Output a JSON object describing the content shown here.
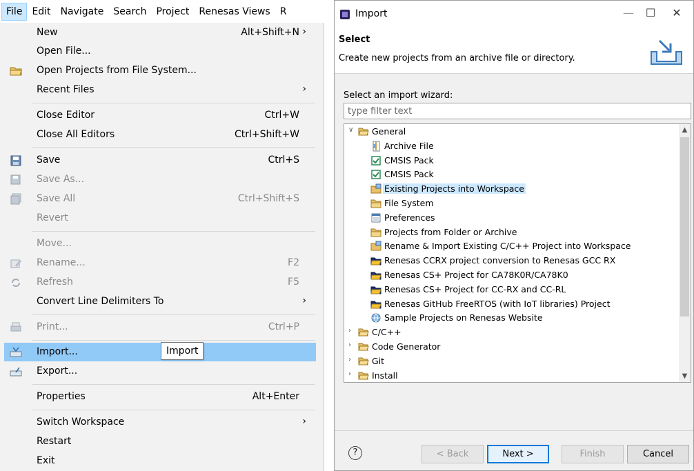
{
  "menubar": {
    "items": [
      "File",
      "Edit",
      "Navigate",
      "Search",
      "Project",
      "Renesas Views",
      "R"
    ]
  },
  "file_menu": {
    "items": [
      {
        "label": "New",
        "accel": "Alt+Shift+N",
        "submenu": true,
        "icon": "none",
        "disabled": false
      },
      {
        "label": "Open File...",
        "accel": "",
        "submenu": false,
        "icon": "none",
        "disabled": false
      },
      {
        "label": "Open Projects from File System...",
        "accel": "",
        "submenu": false,
        "icon": "folder-icon",
        "disabled": false
      },
      {
        "label": "Recent Files",
        "accel": "",
        "submenu": true,
        "icon": "none",
        "disabled": false
      },
      {
        "label": "Close Editor",
        "accel": "Ctrl+W",
        "submenu": false,
        "icon": "none",
        "disabled": false
      },
      {
        "label": "Close All Editors",
        "accel": "Ctrl+Shift+W",
        "submenu": false,
        "icon": "none",
        "disabled": false
      },
      {
        "label": "Save",
        "accel": "Ctrl+S",
        "submenu": false,
        "icon": "save-icon",
        "disabled": false
      },
      {
        "label": "Save As...",
        "accel": "",
        "submenu": false,
        "icon": "save-as-icon",
        "disabled": true
      },
      {
        "label": "Save All",
        "accel": "Ctrl+Shift+S",
        "submenu": false,
        "icon": "save-all-icon",
        "disabled": true
      },
      {
        "label": "Revert",
        "accel": "",
        "submenu": false,
        "icon": "none",
        "disabled": true
      },
      {
        "label": "Move...",
        "accel": "",
        "submenu": false,
        "icon": "none",
        "disabled": true
      },
      {
        "label": "Rename...",
        "accel": "F2",
        "submenu": false,
        "icon": "rename-icon",
        "disabled": true
      },
      {
        "label": "Refresh",
        "accel": "F5",
        "submenu": false,
        "icon": "refresh-icon",
        "disabled": true
      },
      {
        "label": "Convert Line Delimiters To",
        "accel": "",
        "submenu": true,
        "icon": "none",
        "disabled": false
      },
      {
        "label": "Print...",
        "accel": "Ctrl+P",
        "submenu": false,
        "icon": "print-icon",
        "disabled": true
      },
      {
        "label": "Import...",
        "accel": "",
        "submenu": false,
        "icon": "import-icon",
        "disabled": false,
        "selected": true
      },
      {
        "label": "Export...",
        "accel": "",
        "submenu": false,
        "icon": "export-icon",
        "disabled": false
      },
      {
        "label": "Properties",
        "accel": "Alt+Enter",
        "submenu": false,
        "icon": "none",
        "disabled": false
      },
      {
        "label": "Switch Workspace",
        "accel": "",
        "submenu": true,
        "icon": "none",
        "disabled": false
      },
      {
        "label": "Restart",
        "accel": "",
        "submenu": false,
        "icon": "none",
        "disabled": false
      },
      {
        "label": "Exit",
        "accel": "",
        "submenu": false,
        "icon": "none",
        "disabled": false
      }
    ],
    "tooltip": "Import"
  },
  "dialog": {
    "title": "Import",
    "window_buttons": {
      "minimize": "—",
      "maximize": "☐",
      "close": "✕"
    },
    "header_title": "Select",
    "header_desc": "Create new projects from an archive file or directory.",
    "wizard_label": "Select an import wizard:",
    "filter_placeholder": "type filter text",
    "tree": [
      {
        "label": "General",
        "level": 0,
        "expanded": true,
        "icon": "folder-open-icon"
      },
      {
        "label": "Archive File",
        "level": 1,
        "icon": "archive-icon"
      },
      {
        "label": "CMSIS Pack",
        "level": 1,
        "icon": "cmsis-check-icon"
      },
      {
        "label": "CMSIS Pack",
        "level": 1,
        "icon": "cmsis-check-icon"
      },
      {
        "label": "Existing Projects into Workspace",
        "level": 1,
        "icon": "project-folder-icon",
        "highlighted": true
      },
      {
        "label": "File System",
        "level": 1,
        "icon": "folder-icon"
      },
      {
        "label": "Preferences",
        "level": 1,
        "icon": "preferences-icon"
      },
      {
        "label": "Projects from Folder or Archive",
        "level": 1,
        "icon": "folder-icon"
      },
      {
        "label": "Rename & Import Existing C/C++ Project into Workspace",
        "level": 1,
        "icon": "project-folder-icon"
      },
      {
        "label": "Renesas CCRX project conversion to Renesas GCC RX",
        "level": 1,
        "icon": "renesas-folder-icon"
      },
      {
        "label": "Renesas CS+ Project for CA78K0R/CA78K0",
        "level": 1,
        "icon": "renesas-folder-icon"
      },
      {
        "label": "Renesas CS+ Project for CC-RX and CC-RL",
        "level": 1,
        "icon": "renesas-folder-icon"
      },
      {
        "label": "Renesas GitHub FreeRTOS (with IoT libraries) Project",
        "level": 1,
        "icon": "renesas-folder-icon"
      },
      {
        "label": "Sample Projects on Renesas Website",
        "level": 1,
        "icon": "web-icon"
      },
      {
        "label": "C/C++",
        "level": 0,
        "expanded": false,
        "icon": "folder-open-icon"
      },
      {
        "label": "Code Generator",
        "level": 0,
        "expanded": false,
        "icon": "folder-open-icon"
      },
      {
        "label": "Git",
        "level": 0,
        "expanded": false,
        "icon": "folder-open-icon"
      },
      {
        "label": "Install",
        "level": 0,
        "expanded": false,
        "icon": "folder-open-icon"
      }
    ],
    "buttons": {
      "help": "?",
      "back": "< Back",
      "next": "Next >",
      "finish": "Finish",
      "cancel": "Cancel"
    },
    "colors": {
      "selection": "#91c9f7",
      "tree_highlight": "#cce8ff",
      "default_button_border": "#0078d7"
    }
  }
}
